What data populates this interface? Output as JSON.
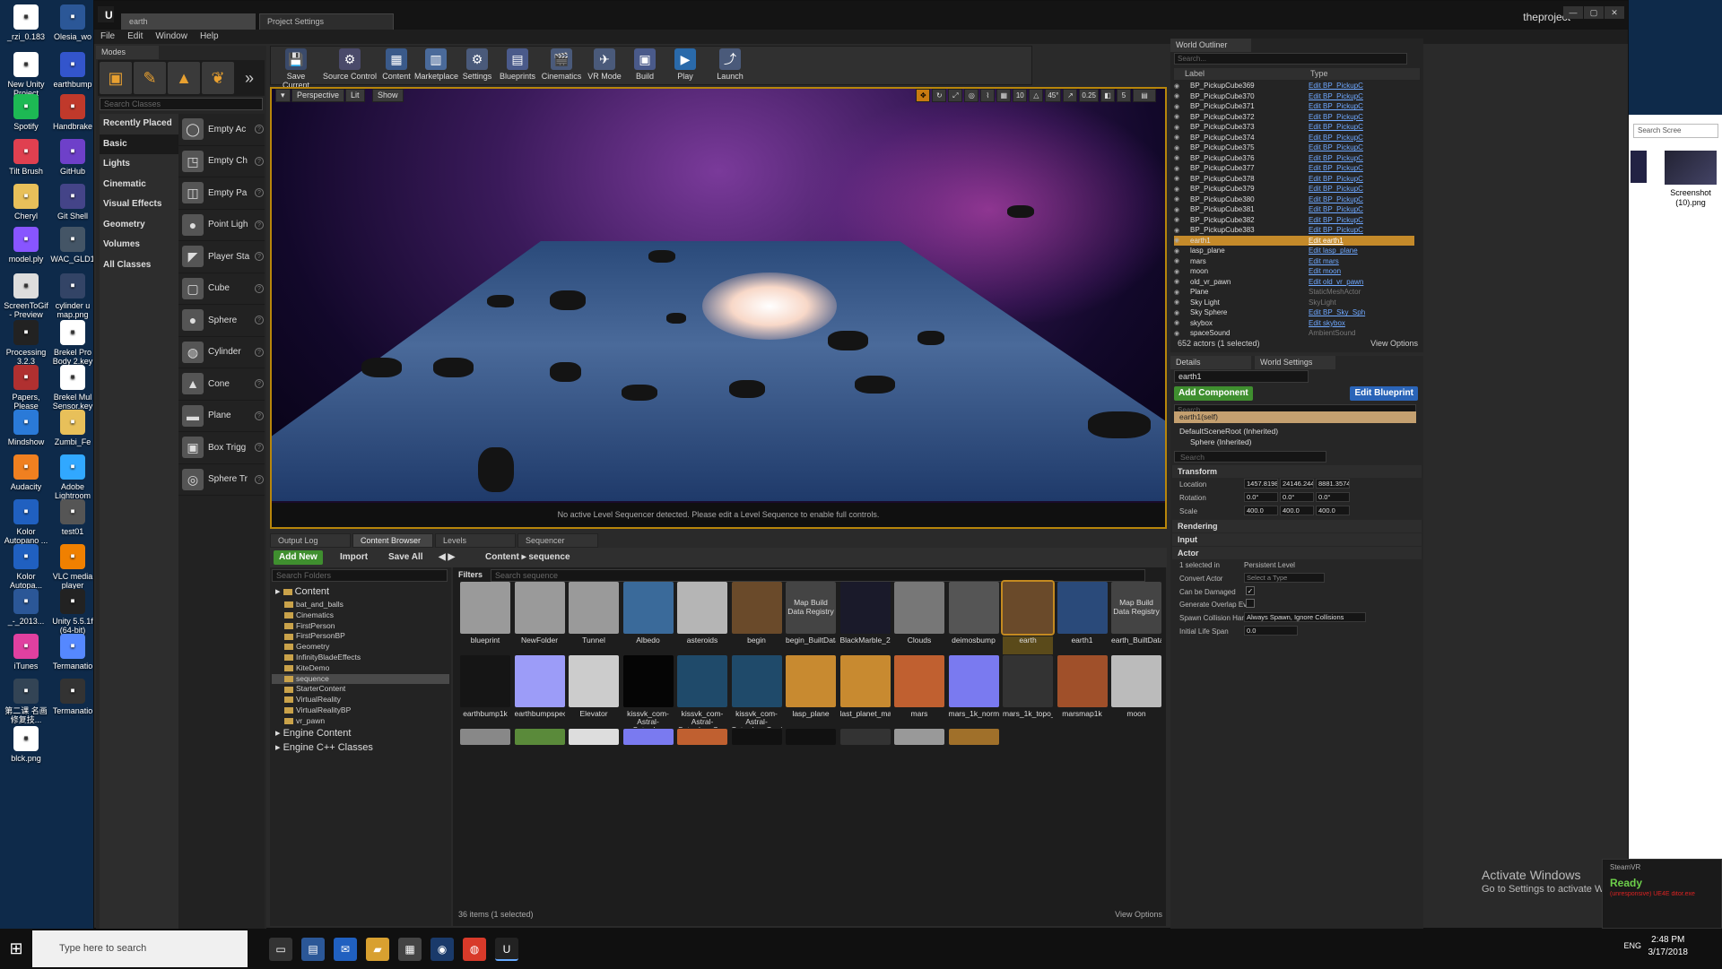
{
  "desktop": {
    "icons": [
      {
        "label": "_rzi_0.183",
        "icon": "file-icon",
        "color": "#ffffff"
      },
      {
        "label": "Olesia_wo",
        "icon": "word-icon",
        "color": "#2b5797"
      },
      {
        "label": "New Unity Project",
        "icon": "file-icon",
        "color": "#ffffff"
      },
      {
        "label": "earthbump",
        "icon": "image-icon",
        "color": "#3355cc"
      },
      {
        "label": "Spotify",
        "icon": "spotify-icon",
        "color": "#1db954"
      },
      {
        "label": "Handbrake",
        "icon": "handbrake-icon",
        "color": "#c0392b"
      },
      {
        "label": "Tilt Brush",
        "icon": "tilt-brush-icon",
        "color": "#e04050"
      },
      {
        "label": "GitHub",
        "icon": "github-icon",
        "color": "#6e40c9"
      },
      {
        "label": "Cheryl",
        "icon": "folder-icon",
        "color": "#e8c05a"
      },
      {
        "label": "Git Shell",
        "icon": "git-shell-icon",
        "color": "#444488"
      },
      {
        "label": "model.ply",
        "icon": "balloon-icon",
        "color": "#8855ff"
      },
      {
        "label": "WAC_GLD1",
        "icon": "image-icon",
        "color": "#445566"
      },
      {
        "label": "ScreenToGif - Preview 12....",
        "icon": "screentogif-icon",
        "color": "#dddddd"
      },
      {
        "label": "cylinder u map.png",
        "icon": "image-icon",
        "color": "#334466"
      },
      {
        "label": "Processing 3.2.3",
        "icon": "processing-icon",
        "color": "#222222"
      },
      {
        "label": "Brekel Pro Body 2.key",
        "icon": "file-icon",
        "color": "#ffffff"
      },
      {
        "label": "Papers, Please",
        "icon": "papers-please-icon",
        "color": "#b03030"
      },
      {
        "label": "Brekel Mul Sensor.key",
        "icon": "file-icon",
        "color": "#ffffff"
      },
      {
        "label": "Mindshow",
        "icon": "mindshow-icon",
        "color": "#2a7ad8"
      },
      {
        "label": "Zumbi_Fe",
        "icon": "file-icon",
        "color": "#e8c05a"
      },
      {
        "label": "Audacity",
        "icon": "audacity-icon",
        "color": "#f08020"
      },
      {
        "label": "Adobe Lightroom",
        "icon": "lightroom-icon",
        "color": "#31a8ff"
      },
      {
        "label": "Kolor Autopano ...",
        "icon": "kolor-icon",
        "color": "#2060c0"
      },
      {
        "label": "test01",
        "icon": "image-icon",
        "color": "#555555"
      },
      {
        "label": "Kolor Autopa...",
        "icon": "kolor-icon",
        "color": "#2060c0"
      },
      {
        "label": "VLC media player",
        "icon": "vlc-icon",
        "color": "#f08000"
      },
      {
        "label": "_-_2013...",
        "icon": "file-icon",
        "color": "#2b5797"
      },
      {
        "label": "Unity 5.5.1f (64-bit)",
        "icon": "unity-icon",
        "color": "#222222"
      },
      {
        "label": "iTunes",
        "icon": "itunes-icon",
        "color": "#e040a0"
      },
      {
        "label": "Termanatio",
        "icon": "balloon-icon",
        "color": "#5588ff"
      },
      {
        "label": "第二课 名画 修复技...",
        "icon": "image-icon",
        "color": "#334455"
      },
      {
        "label": "Termanatio",
        "icon": "termanatio-icon",
        "color": "#333333"
      },
      {
        "label": "blck.png",
        "icon": "file-icon",
        "color": "#ffffff"
      }
    ]
  },
  "bg_window": {
    "search": "Search Scree",
    "caption": "Screenshot (10).png"
  },
  "ue": {
    "tabs": [
      "earth",
      "Project Settings"
    ],
    "project_name": "theproject",
    "menu": [
      "File",
      "Edit",
      "Window",
      "Help"
    ],
    "modes_tab": "Modes",
    "search_classes_placeholder": "Search Classes",
    "categories": [
      "Recently Placed",
      "Basic",
      "Lights",
      "Cinematic",
      "Visual Effects",
      "Geometry",
      "Volumes",
      "All Classes"
    ],
    "selected_category": "Basic",
    "placeables": [
      "Empty Ac",
      "Empty Ch",
      "Empty Pa",
      "Point Ligh",
      "Player Sta",
      "Cube",
      "Sphere",
      "Cylinder",
      "Cone",
      "Plane",
      "Box Trigg",
      "Sphere Tr"
    ],
    "toolbar": [
      {
        "label": "Save Current",
        "icon": "save-icon"
      },
      {
        "label": "Source Control",
        "icon": "source-control-icon"
      },
      {
        "label": "Content",
        "icon": "content-icon"
      },
      {
        "label": "Marketplace",
        "icon": "marketplace-icon"
      },
      {
        "label": "Settings",
        "icon": "settings-icon"
      },
      {
        "label": "Blueprints",
        "icon": "blueprints-icon"
      },
      {
        "label": "Cinematics",
        "icon": "cinematics-icon"
      },
      {
        "label": "VR Mode",
        "icon": "vr-mode-icon"
      },
      {
        "label": "Build",
        "icon": "build-icon"
      },
      {
        "label": "Play",
        "icon": "play-icon"
      },
      {
        "label": "Launch",
        "icon": "launch-icon"
      }
    ],
    "viewport": {
      "perspective": "Perspective",
      "lit": "Lit",
      "show": "Show",
      "grid_snap": "10",
      "rot_snap": "45°",
      "scale_snap": "0.25",
      "cam_speed": "5",
      "sequencer_msg": "No active Level Sequencer detected. Please edit a Level Sequence to enable full controls."
    },
    "bottom_tabs": [
      "Output Log",
      "Content Browser",
      "Levels",
      "Sequencer"
    ],
    "content_browser": {
      "add_new": "Add New",
      "import": "Import",
      "save_all": "Save All",
      "crumb_root": "Content",
      "crumb_leaf": "sequence",
      "search_folders": "Search Folders",
      "filters": "Filters",
      "search_assets": "Search sequence",
      "tree": [
        {
          "label": "Content",
          "big": true
        },
        {
          "label": "bat_and_balls"
        },
        {
          "label": "Cinematics"
        },
        {
          "label": "FirstPerson"
        },
        {
          "label": "FirstPersonBP"
        },
        {
          "label": "Geometry"
        },
        {
          "label": "InfinityBladeEffects"
        },
        {
          "label": "KiteDemo"
        },
        {
          "label": "sequence",
          "selected": true
        },
        {
          "label": "StarterContent"
        },
        {
          "label": "VirtualReality"
        },
        {
          "label": "VirtualRealityBP"
        },
        {
          "label": "vr_pawn"
        },
        {
          "label": "Engine Content",
          "big": true
        },
        {
          "label": "Engine C++ Classes",
          "big": true
        }
      ],
      "assets_row1": [
        {
          "label": "blueprint",
          "color": "#9a9a9a"
        },
        {
          "label": "NewFolder",
          "color": "#9a9a9a"
        },
        {
          "label": "Tunnel",
          "color": "#9a9a9a"
        },
        {
          "label": "Albedo",
          "color": "#3a6a9a"
        },
        {
          "label": "asteroids",
          "color": "#b5b5b5"
        },
        {
          "label": "begin",
          "color": "#6a4a2a"
        },
        {
          "label": "begin_BuiltData",
          "color": "#444444",
          "text": "Map Build Data Registry"
        },
        {
          "label": "BlackMarble_2016_3km",
          "color": "#1a1a2a"
        },
        {
          "label": "Clouds",
          "color": "#777777"
        },
        {
          "label": "deimosbump",
          "color": "#555555"
        },
        {
          "label": "earth",
          "color": "#6a4a2a",
          "selected": true
        },
        {
          "label": "earth1",
          "color": "#2a4a7a"
        },
        {
          "label": "earth_BuiltData",
          "color": "#444444",
          "text": "Map Build Data Registry"
        }
      ],
      "assets_row2": [
        {
          "label": "earthbump1k",
          "color": "#151515"
        },
        {
          "label": "earthbumpspec_8K_Earth_Normal_Map_1",
          "color": "#9c9cf8"
        },
        {
          "label": "Elevator",
          "color": "#cccccc"
        },
        {
          "label": "kissvk_com-Astral-Saturday",
          "color": "#050505"
        },
        {
          "label": "kissvk_com-Astral-Saturday_Cue",
          "color": "#1f4a6a"
        },
        {
          "label": "kissvk_com-Astral-Saturday_Cue1",
          "color": "#1f4a6a"
        },
        {
          "label": "lasp_plane",
          "color": "#c88a30"
        },
        {
          "label": "last_planet_mat",
          "color": "#c88a30"
        },
        {
          "label": "mars",
          "color": "#c06030"
        },
        {
          "label": "mars_1k_normal_1",
          "color": "#7a7af0"
        },
        {
          "label": "mars_1k_topo_1",
          "color": "#333333"
        },
        {
          "label": "marsmap1k",
          "color": "#a0502a"
        },
        {
          "label": "moon",
          "color": "#bbbbbb"
        }
      ],
      "status": "36 items (1 selected)",
      "view_options": "View Options"
    },
    "outliner": {
      "tab": "World Outliner",
      "search": "Search...",
      "col_label": "Label",
      "col_type": "Type",
      "rows": [
        {
          "label": "BP_PickupCube369",
          "type": "Edit BP_PickupC"
        },
        {
          "label": "BP_PickupCube370",
          "type": "Edit BP_PickupC"
        },
        {
          "label": "BP_PickupCube371",
          "type": "Edit BP_PickupC"
        },
        {
          "label": "BP_PickupCube372",
          "type": "Edit BP_PickupC"
        },
        {
          "label": "BP_PickupCube373",
          "type": "Edit BP_PickupC"
        },
        {
          "label": "BP_PickupCube374",
          "type": "Edit BP_PickupC"
        },
        {
          "label": "BP_PickupCube375",
          "type": "Edit BP_PickupC"
        },
        {
          "label": "BP_PickupCube376",
          "type": "Edit BP_PickupC"
        },
        {
          "label": "BP_PickupCube377",
          "type": "Edit BP_PickupC"
        },
        {
          "label": "BP_PickupCube378",
          "type": "Edit BP_PickupC"
        },
        {
          "label": "BP_PickupCube379",
          "type": "Edit BP_PickupC"
        },
        {
          "label": "BP_PickupCube380",
          "type": "Edit BP_PickupC"
        },
        {
          "label": "BP_PickupCube381",
          "type": "Edit BP_PickupC"
        },
        {
          "label": "BP_PickupCube382",
          "type": "Edit BP_PickupC"
        },
        {
          "label": "BP_PickupCube383",
          "type": "Edit BP_PickupC"
        },
        {
          "label": "earth1",
          "type": "Edit earth1",
          "selected": true
        },
        {
          "label": "lasp_plane",
          "type": "Edit lasp_plane"
        },
        {
          "label": "mars",
          "type": "Edit mars"
        },
        {
          "label": "moon",
          "type": "Edit moon"
        },
        {
          "label": "old_vr_pawn",
          "type": "Edit old_vr_pawn"
        },
        {
          "label": "Plane",
          "type": "StaticMeshActor",
          "plain": true
        },
        {
          "label": "Sky Light",
          "type": "SkyLight",
          "plain": true
        },
        {
          "label": "Sky Sphere",
          "type": "Edit BP_Sky_Sph"
        },
        {
          "label": "skybox",
          "type": "Edit skybox"
        },
        {
          "label": "spaceSound",
          "type": "AmbientSound",
          "plain": true
        }
      ],
      "status": "652 actors (1 selected)",
      "view_options": "View Options"
    },
    "details": {
      "tab": "Details",
      "tab2": "World Settings",
      "name": "earth1",
      "add_component": "Add Component",
      "edit_blueprint": "Edit Blueprint",
      "search": "Search",
      "comp_self": "earth1(self)",
      "comp_root": "DefaultSceneRoot (Inherited)",
      "comp_sphere": "Sphere (Inherited)",
      "search2": "Search",
      "transform": "Transform",
      "location_label": "Location",
      "location": [
        "1457.8198",
        "24146.244",
        "8881.35742"
      ],
      "rotation_label": "Rotation",
      "rotation": [
        "0.0°",
        "0.0°",
        "0.0°"
      ],
      "scale_label": "Scale",
      "scale": [
        "400.0",
        "400.0",
        "400.0"
      ],
      "rendering": "Rendering",
      "input": "Input",
      "actor": "Actor",
      "selected_in": "1 selected in",
      "persistent_level": "Persistent Level",
      "convert_actor": "Convert Actor",
      "select_type": "Select a Type",
      "can_be_damaged": "Can be Damaged",
      "gen_overlap": "Generate Overlap Eve",
      "spawn_collision": "Spawn Collision Hand",
      "spawn_value": "Always Spawn, Ignore Collisions",
      "initial_life": "Initial Life Span",
      "life_value": "0.0"
    }
  },
  "overlays": {
    "activate_title": "Activate Windows",
    "activate_sub": "Go to Settings to activate Windows.",
    "steamvr_title": "SteamVR",
    "steamvr_ready": "Ready",
    "steamvr_error": "(unresponsive) UE4E ditor.exe"
  },
  "taskbar": {
    "search_placeholder": "Type here to search",
    "lang": "ENG",
    "time": "2:48 PM",
    "date": "3/17/2018"
  }
}
